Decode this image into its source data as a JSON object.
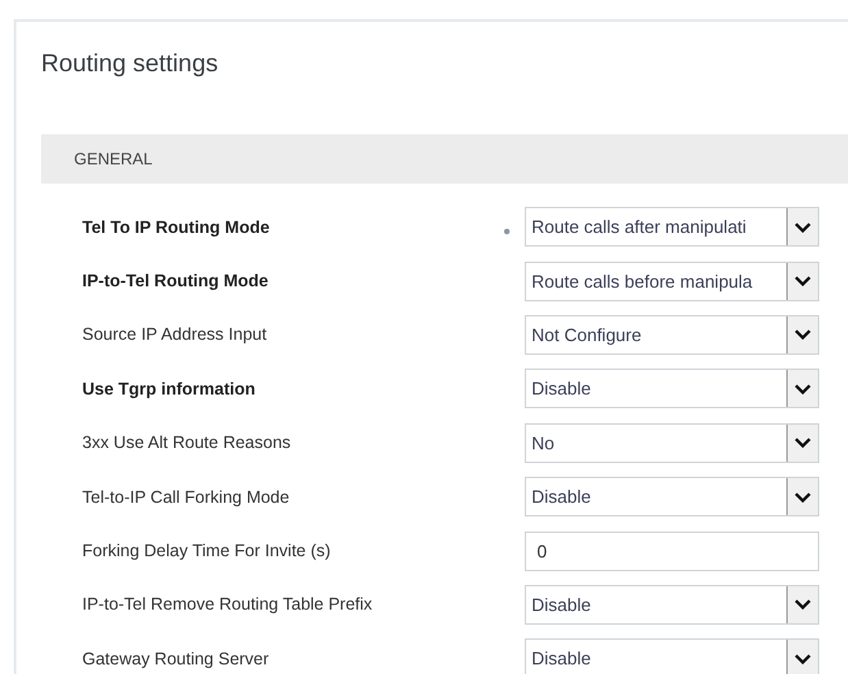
{
  "title": "Routing settings",
  "section": "GENERAL",
  "rows": [
    {
      "label": "Tel To IP Routing Mode",
      "bold": true,
      "modified": true,
      "kind": "select",
      "value": "Route calls after manipulati"
    },
    {
      "label": "IP-to-Tel Routing Mode",
      "bold": true,
      "modified": false,
      "kind": "select",
      "value": "Route calls before manipula"
    },
    {
      "label": "Source IP Address Input",
      "bold": false,
      "modified": false,
      "kind": "select",
      "value": "Not Configure"
    },
    {
      "label": "Use Tgrp information",
      "bold": true,
      "modified": false,
      "kind": "select",
      "value": "Disable"
    },
    {
      "label": "3xx Use Alt Route Reasons",
      "bold": false,
      "modified": false,
      "kind": "select",
      "value": "No"
    },
    {
      "label": "Tel-to-IP Call Forking Mode",
      "bold": false,
      "modified": false,
      "kind": "select",
      "value": "Disable"
    },
    {
      "label": "Forking Delay Time For Invite (s)",
      "bold": false,
      "modified": false,
      "kind": "text",
      "value": "0"
    },
    {
      "label": "IP-to-Tel Remove Routing Table Prefix",
      "bold": false,
      "modified": false,
      "kind": "select",
      "value": "Disable"
    },
    {
      "label": "Gateway Routing Server",
      "bold": false,
      "modified": false,
      "kind": "select",
      "value": "Disable"
    }
  ]
}
